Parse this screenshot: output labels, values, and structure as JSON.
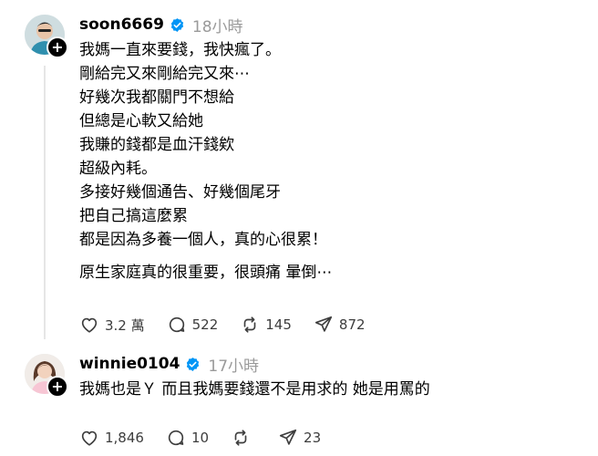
{
  "posts": [
    {
      "username": "soon6669",
      "time": "18小時",
      "lines": [
        "我媽一直來要錢，我快瘋了。",
        "剛給完又來剛給完又來⋯",
        "好幾次我都關門不想給",
        "但總是心軟又給她",
        "我賺的錢都是血汗錢欸",
        "超級內耗。",
        "多接好幾個通告、好幾個尾牙",
        "把自己搞這麼累",
        "都是因為多養一個人，真的心很累！"
      ],
      "closing_line": "原生家庭真的很重要，很頭痛 暈倒⋯",
      "stats": {
        "likes": "3.2 萬",
        "replies": "522",
        "reposts": "145",
        "shares": "872"
      },
      "icons": [
        "heart-icon",
        "comment-icon",
        "repost-icon",
        "send-icon",
        "verified-icon",
        "plus-icon"
      ]
    },
    {
      "username": "winnie0104",
      "time": "17小時",
      "lines": [
        "我媽也是Ｙ 而且我媽要錢還不是用求的 她是用罵的"
      ],
      "stats": {
        "likes": "1,846",
        "replies": "10",
        "reposts": "",
        "shares": "23"
      },
      "icons": [
        "heart-icon",
        "comment-icon",
        "repost-icon",
        "send-icon",
        "verified-icon",
        "plus-icon"
      ]
    }
  ],
  "follow_badge_symbol": "+",
  "colors": {
    "verified": "#0095f6",
    "text": "#000000",
    "muted": "#9a9a9a",
    "icon": "#3d3d3d",
    "thread_line": "#e6e6e6"
  }
}
